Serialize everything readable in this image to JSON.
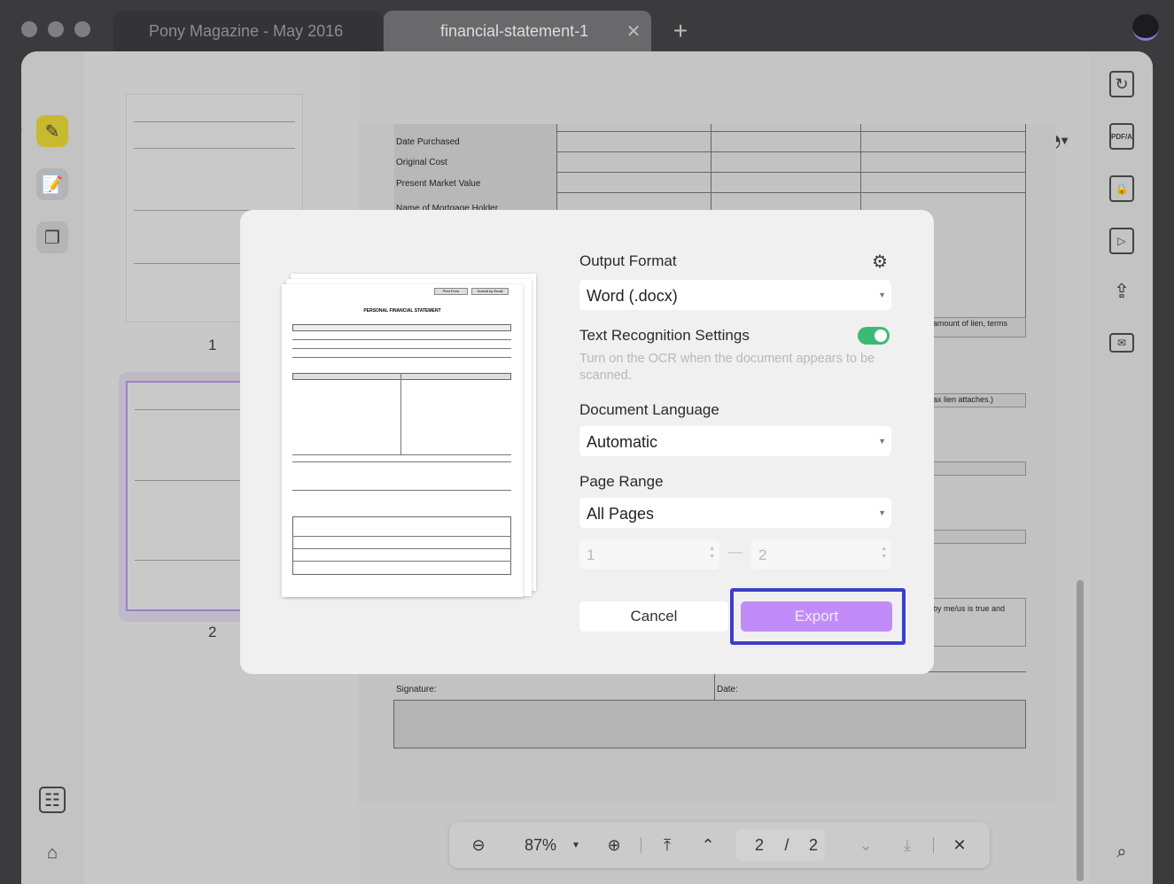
{
  "window": {
    "tabs": [
      {
        "label": "Pony Magazine - May 2016",
        "active": false
      },
      {
        "label": "financial-statement-1",
        "active": true
      }
    ],
    "new_tab_icon": "plus-icon",
    "close_tab_icon": "close-icon"
  },
  "toolbar": {
    "icons": [
      "comment-icon",
      "highlighter-icon",
      "strikethrough-icon",
      "underline-icon",
      "squiggly-underline-icon",
      "text-icon",
      "text-box-icon",
      "text-callout-icon",
      "pencil-icon",
      "eraser-icon",
      "shape-circle-icon",
      "stamp-icon"
    ]
  },
  "left_sidebar": {
    "icons": [
      "highlighter-icon",
      "edit-icon",
      "pages-icon",
      "form-icon",
      "bookmark-icon"
    ]
  },
  "thumbnails": [
    {
      "label": "1"
    },
    {
      "label": "2"
    }
  ],
  "document": {
    "rows": [
      "Date Purchased",
      "Original Cost",
      "Present Market Value",
      "Name of Mortgage Holder"
    ],
    "fragments": [
      "amount of lien, terms",
      "ax lien attaches.)",
      "by me/us is true and"
    ],
    "signature_label": "Signature:",
    "date_label": "Date:"
  },
  "right_sidebar": {
    "icons": [
      "convert-icon",
      "pdfa-icon",
      "protect-icon",
      "slideshow-icon",
      "share-icon",
      "mail-icon",
      "search-icon"
    ]
  },
  "bottom_nav": {
    "zoom": "87%",
    "current_page": "2",
    "separator": "/",
    "total_pages": "2"
  },
  "export_dialog": {
    "preview": {
      "title": "PERSONAL FINANCIAL STATEMENT",
      "print_button": "Print Form",
      "submit_button": "Submit by Email"
    },
    "output_format_label": "Output Format",
    "output_format_value": "Word (.docx)",
    "ocr_label": "Text Recognition Settings",
    "ocr_enabled": true,
    "ocr_help": "Turn on the OCR when the document appears to be scanned.",
    "language_label": "Document Language",
    "language_value": "Automatic",
    "page_range_label": "Page Range",
    "page_range_value": "All Pages",
    "range_from": "1",
    "range_to": "2",
    "range_dash": "—",
    "cancel_label": "Cancel",
    "export_label": "Export",
    "colors": {
      "export": "#c18cf7",
      "highlight": "#3b3fc7",
      "toggle": "#3cba74"
    }
  }
}
